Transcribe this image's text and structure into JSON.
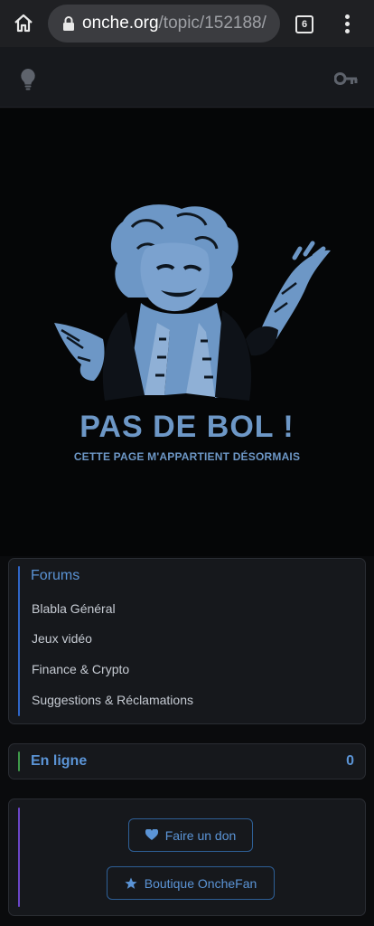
{
  "browser": {
    "url_host": "onche.org",
    "url_path": "/topic/152188/",
    "tab_count": "6"
  },
  "hero": {
    "title": "PAS DE BOL !",
    "subtitle": "CETTE PAGE M'APPARTIENT DÉSORMAIS"
  },
  "forums": {
    "title": "Forums",
    "items": [
      {
        "label": "Blabla Général"
      },
      {
        "label": "Jeux vidéo"
      },
      {
        "label": "Finance & Crypto"
      },
      {
        "label": "Suggestions & Réclamations"
      }
    ]
  },
  "online": {
    "label": "En ligne",
    "count": "0"
  },
  "support": {
    "donate_label": "Faire un don",
    "shop_label": "Boutique OncheFan"
  },
  "colors": {
    "accent_blue": "#5b94d6",
    "forums_accent": "#2f66c8",
    "online_accent": "#3f9a4a",
    "support_accent": "#6a46c8"
  }
}
